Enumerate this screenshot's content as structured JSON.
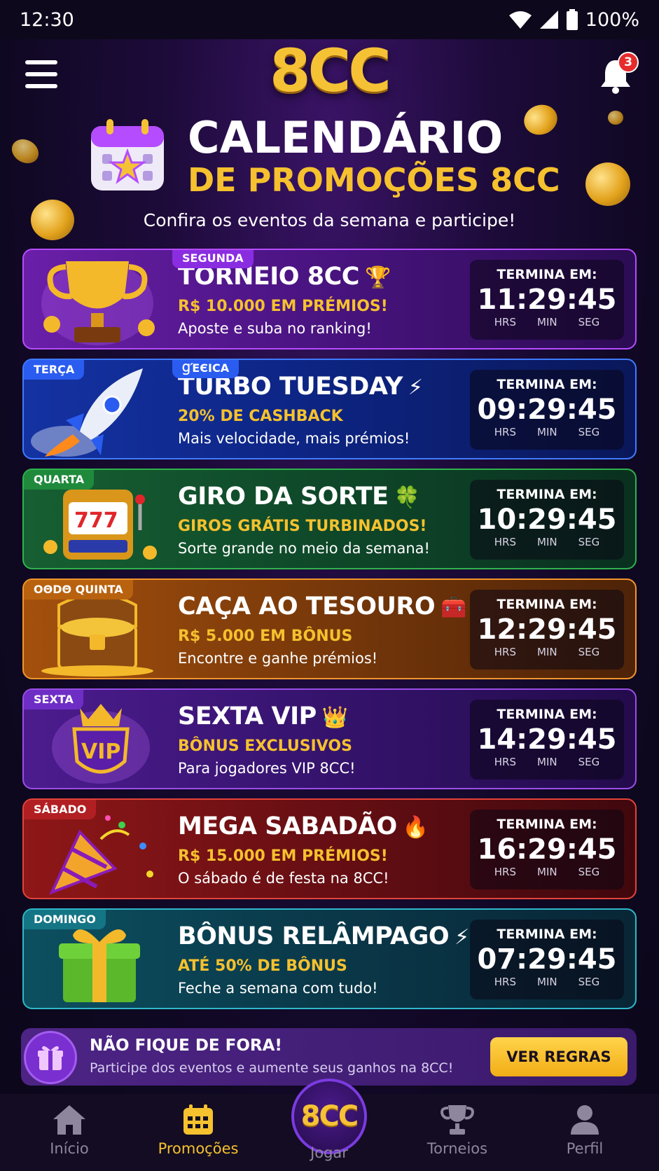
{
  "status": {
    "time": "12:30",
    "battery": "100%"
  },
  "header": {
    "logo": "8CC",
    "notifications": "3"
  },
  "hero": {
    "title_line1": "CALENDÁRIO",
    "title_line2": "DE PROMOÇÕES 8CC",
    "subtitle": "Confira os eventos da semana e participe!"
  },
  "timer_labels": {
    "ends_in": "TERMINA EM:",
    "hrs": "HRS",
    "min": "MIN",
    "seg": "SEG"
  },
  "events": [
    {
      "day": "SEGUNDA",
      "title": "TORNEIO 8CC",
      "emoji": "🏆",
      "prize": "R$ 10.000 EM PRÉMIOS!",
      "desc": "Aposte e suba no ranking!",
      "time": "11:29:45"
    },
    {
      "day": "TERÇA",
      "day2": "ꞬΈЄICA",
      "title": "TURBO TUESDAY",
      "emoji": "⚡",
      "prize": "20% DE CASHBACK",
      "desc": "Mais velocidade, mais prémios!",
      "time": "09:29:45"
    },
    {
      "day": "QUARTA",
      "title": "GIRO DA SORTE",
      "emoji": "🍀",
      "prize": "GIROS GRÁTIS TURBINADOS!",
      "desc": "Sorte grande no meio da semana!",
      "time": "10:29:45"
    },
    {
      "day": "OΘDΘ QUINTA",
      "title": "CAÇA AO TESOURO",
      "emoji": "🧰",
      "prize": "R$ 5.000 EM BÔNUS",
      "desc": "Encontre e ganhe prémios!",
      "time": "12:29:45"
    },
    {
      "day": "SEXTA",
      "title": "SEXTA VIP",
      "emoji": "👑",
      "prize": "BÔNUS EXCLUSIVOS",
      "desc": "Para jogadores VIP 8CC!",
      "time": "14:29:45",
      "art_text": "VIP"
    },
    {
      "day": "SÁBADO",
      "title": "MEGA SABADÃO",
      "emoji": "🔥",
      "prize": "R$ 15.000 EM PRÉMIOS!",
      "desc": "O sábado é de festa na 8CC!",
      "time": "16:29:45"
    },
    {
      "day": "DOMINGO",
      "title": "BÔNUS RELÂMPAGO",
      "emoji": "⚡",
      "prize": "ATÉ 50% DE BÔNUS",
      "desc": "Feche a semana com tudo!",
      "time": "07:29:45"
    }
  ],
  "cta": {
    "title": "NÃO FIQUE DE FORA!",
    "subtitle": "Participe dos eventos e aumente seus ganhos na 8CC!",
    "button": "VER REGRAS"
  },
  "tabs": {
    "home": "Início",
    "promos": "Promoções",
    "play": "Jogar",
    "play_logo": "8CC",
    "tournaments": "Torneios",
    "profile": "Perfil"
  },
  "colors": {
    "accent": "#f5c12e",
    "background": "#0f0822"
  }
}
